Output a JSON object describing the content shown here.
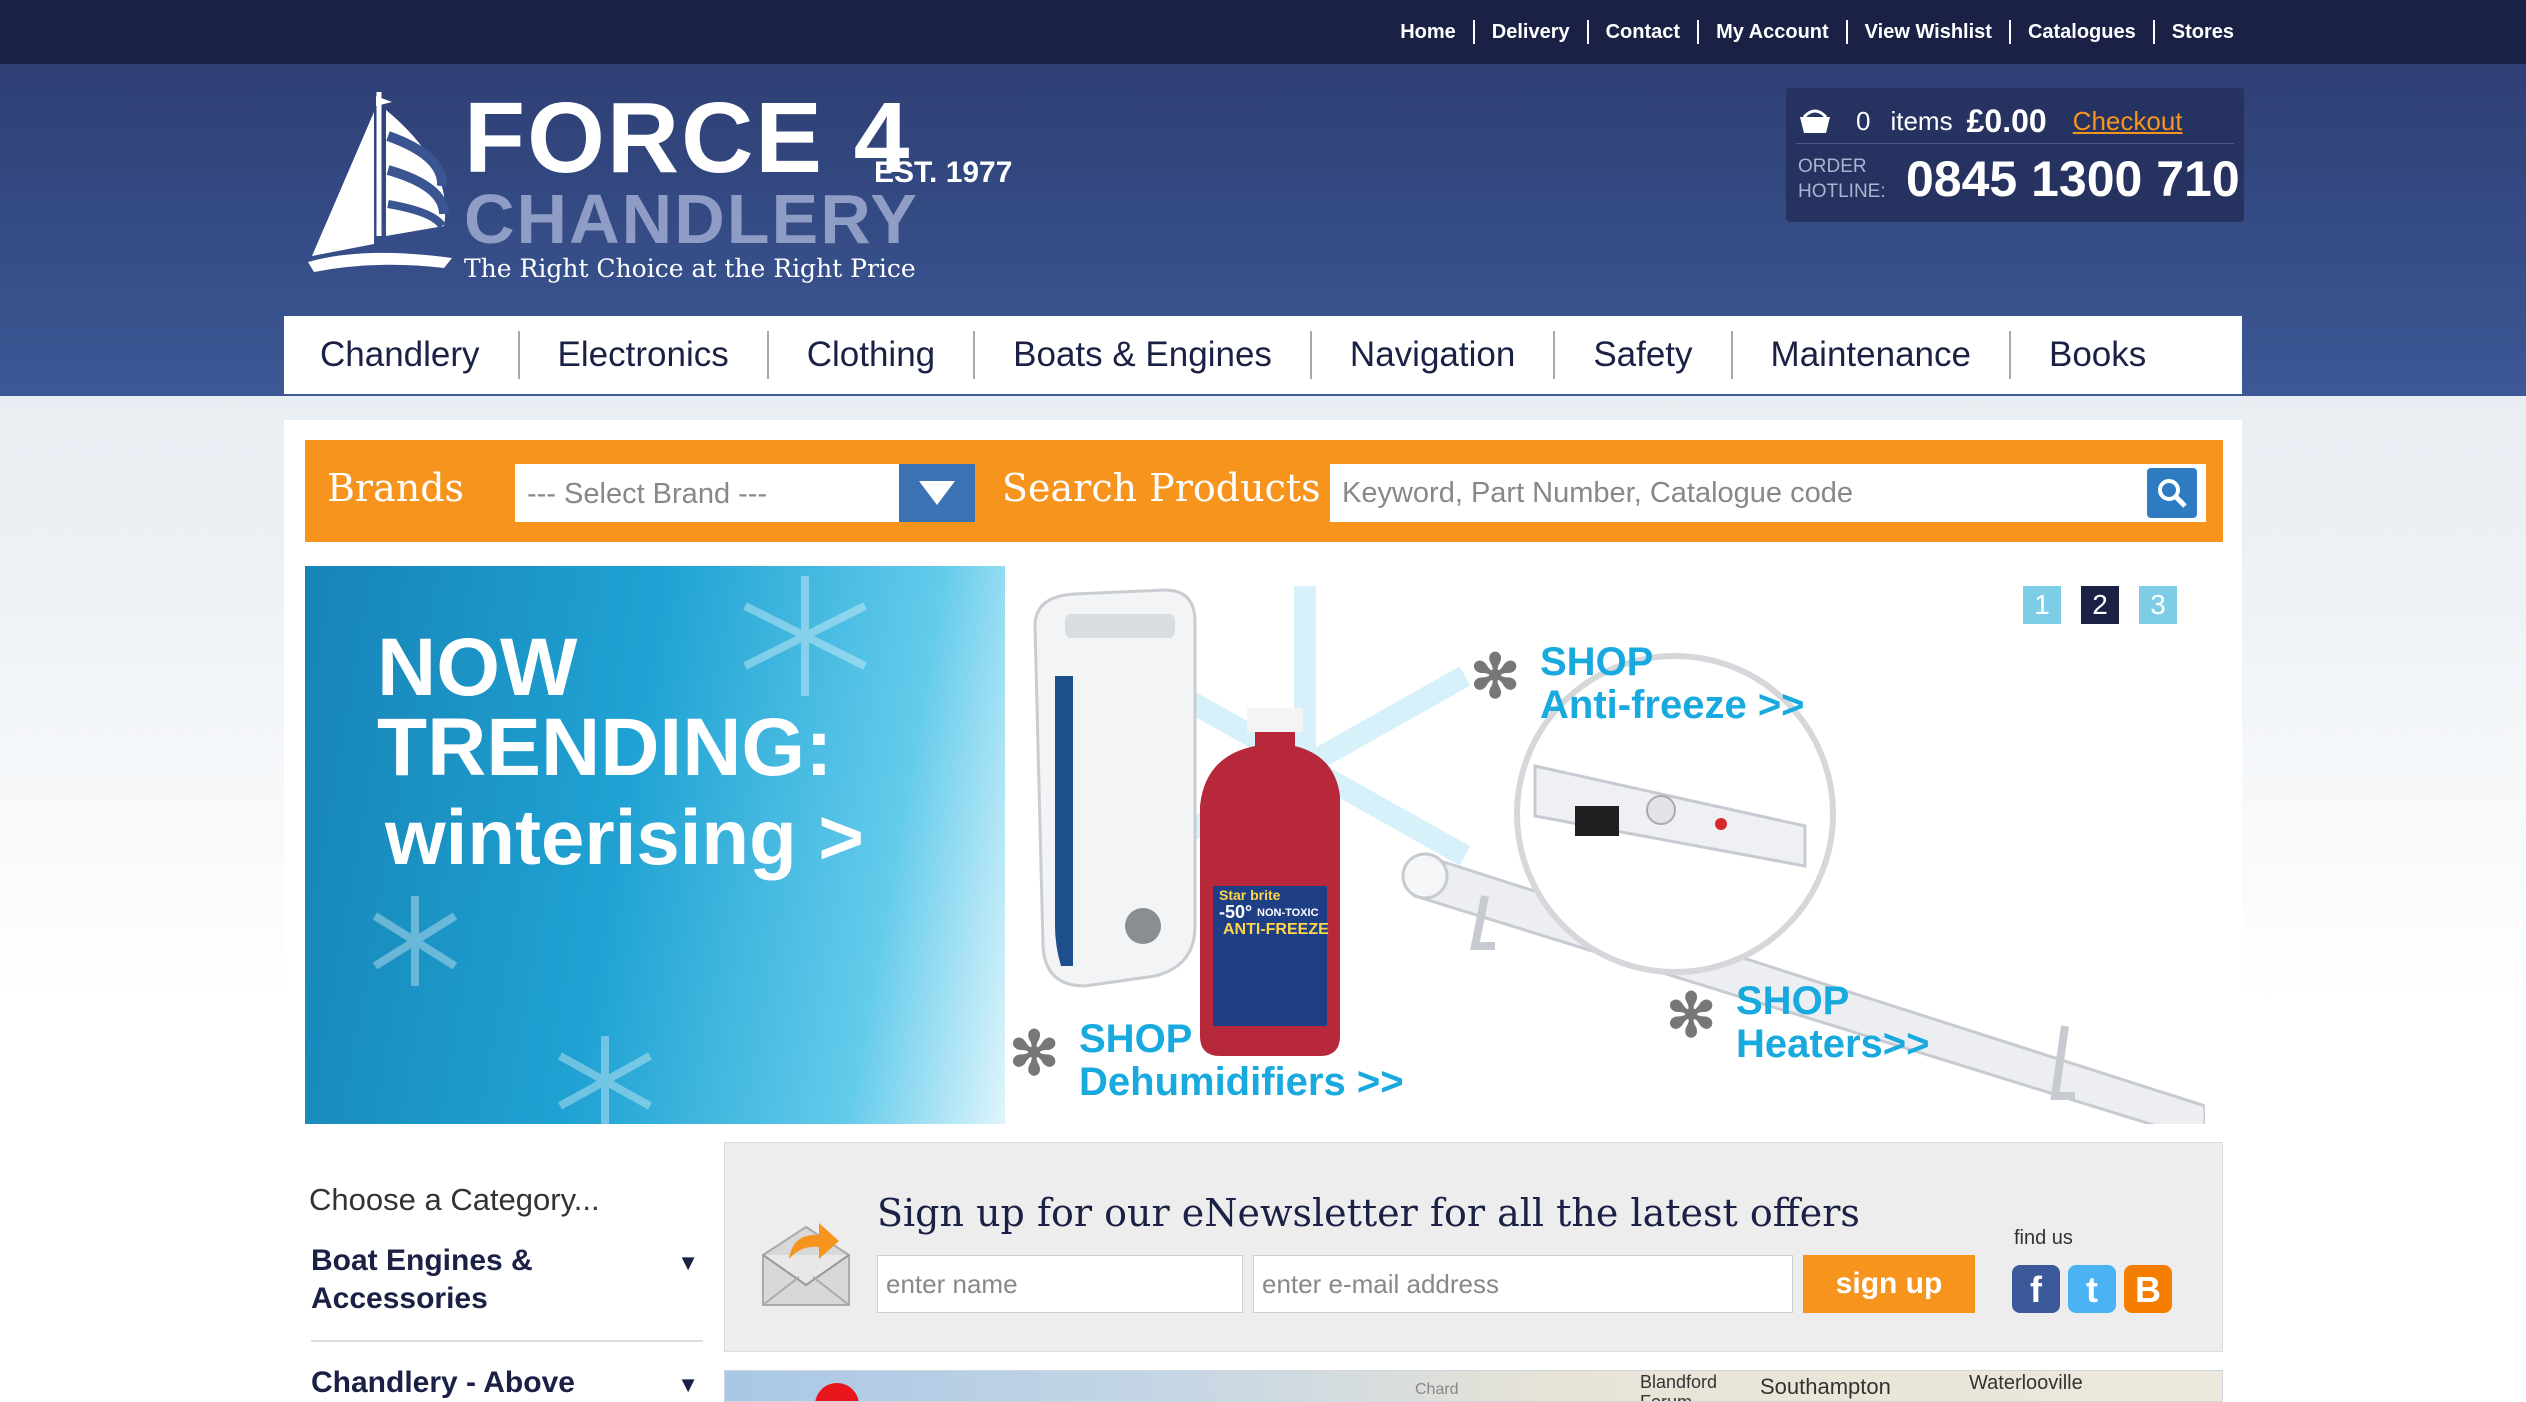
{
  "top_links": [
    "Home",
    "Delivery",
    "Contact",
    "My Account",
    "View Wishlist",
    "Catalogues",
    "Stores"
  ],
  "logo": {
    "name": "FORCE 4",
    "est": "EST. 1977",
    "sub": "CHANDLERY",
    "tagline": "The Right Choice at the Right Price"
  },
  "cart": {
    "count": "0",
    "items_label": "items",
    "total": "£0.00",
    "checkout": "Checkout",
    "hotline_label": "ORDER HOTLINE:",
    "hotline_number": "0845 1300 710"
  },
  "nav": [
    "Chandlery",
    "Electronics",
    "Clothing",
    "Boats & Engines",
    "Navigation",
    "Safety",
    "Maintenance",
    "Books"
  ],
  "search": {
    "brands_label": "Brands",
    "brand_select": "--- Select Brand ---",
    "search_label": "Search Products",
    "placeholder": "Keyword, Part Number, Catalogue code"
  },
  "banner": {
    "headline": "NOW TRENDING:",
    "subline": "winterising >",
    "links": [
      {
        "line1": "SHOP",
        "line2": "Anti-freeze >>"
      },
      {
        "line1": "SHOP",
        "line2": "Dehumidifiers >>"
      },
      {
        "line1": "SHOP",
        "line2": "Heaters>>"
      }
    ],
    "bottle_label": "ANTI-FREEZE",
    "bottle_brand": "Star brite",
    "bottle_temp": "-50°",
    "bottle_desc": "NON-TOXIC",
    "slides": [
      "1",
      "2",
      "3"
    ],
    "active_slide": 2
  },
  "sidebar": {
    "title": "Choose a Category...",
    "items": [
      "Boat Engines & Accessories",
      "Chandlery - Above"
    ]
  },
  "newsletter": {
    "title": "Sign up for our eNewsletter for all the latest offers",
    "name_placeholder": "enter name",
    "email_placeholder": "enter e-mail address",
    "button": "sign up",
    "find_us": "find us"
  },
  "map": {
    "labels": [
      "Chard",
      "Blandford Forum",
      "Southampton",
      "Waterlooville"
    ]
  },
  "colors": {
    "navy": "#1b2145",
    "orange": "#f6941e",
    "blue_button": "#3a72b4",
    "banner_blue": "#18a9df"
  }
}
